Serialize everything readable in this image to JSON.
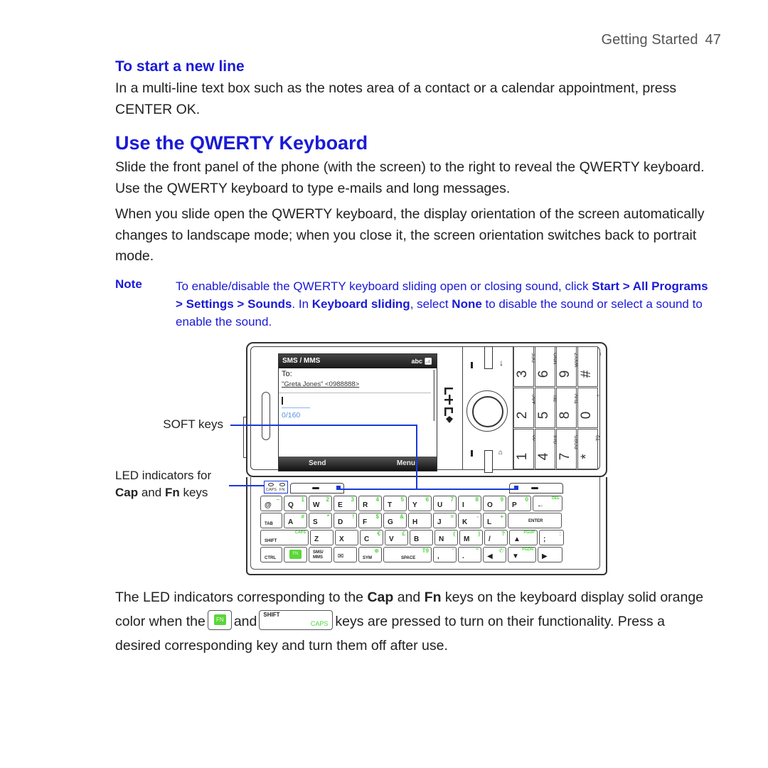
{
  "header": {
    "section": "Getting Started",
    "page_number": "47"
  },
  "new_line": {
    "heading": "To start a new line",
    "body": "In a multi-line text box such as the notes area of a contact or a calendar appointment, press CENTER OK."
  },
  "qwerty": {
    "heading": "Use the QWERTY Keyboard",
    "para1": "Slide the front panel of the phone (with the screen) to the right to reveal the QWERTY keyboard. Use the QWERTY keyboard to type e-mails and long messages.",
    "para2": "When you slide open the QWERTY keyboard, the display orientation of the screen automatically changes to landscape mode; when you close it, the screen orientation switches back to portrait mode."
  },
  "note": {
    "label": "Note",
    "t1": "To enable/disable the QWERTY keyboard sliding open or closing sound, click ",
    "b1": "Start > All Programs > Settings > Sounds",
    "t2": ". In ",
    "b2": "Keyboard sliding",
    "t3": ", select ",
    "b3": "None",
    "t4": " to disable the sound or select a sound to enable the sound."
  },
  "callouts": {
    "soft_keys": "SOFT keys",
    "led_line1": "LED indicators for",
    "led_cap": "Cap",
    "led_and": " and ",
    "led_fn": "Fn",
    "led_keys": " keys"
  },
  "phone_screen": {
    "title": "SMS / MMS",
    "input_mode": "abc",
    "to_label": "To:",
    "recipient": "\"Greta Jones\" <0988888>",
    "char_count": "0/160",
    "soft_left": "Send",
    "soft_right": "Menu"
  },
  "phone_brand": "htc",
  "numpad": [
    {
      "digit": "3",
      "sub": "DEF"
    },
    {
      "digit": "6",
      "sub": "MNO"
    },
    {
      "digit": "9",
      "sub": "WXYZ"
    },
    {
      "digit": "#",
      "sub": "_"
    },
    {
      "digit": "2",
      "sub": "ABC"
    },
    {
      "digit": "5",
      "sub": "JKL"
    },
    {
      "digit": "8",
      "sub": "TUV"
    },
    {
      "digit": "0",
      "sub": "+"
    },
    {
      "digit": "1",
      "sub": "oo"
    },
    {
      "digit": "4",
      "sub": "GHI"
    },
    {
      "digit": "7",
      "sub": "PQRS"
    },
    {
      "digit": "*",
      "sub": "T9"
    }
  ],
  "led_labels": {
    "caps": "CAPS",
    "fn": "FN"
  },
  "keyboard": {
    "row1": [
      {
        "m": "@",
        "f": "–"
      },
      {
        "m": "Q",
        "f": "1"
      },
      {
        "m": "W",
        "f": "2"
      },
      {
        "m": "E",
        "f": "3"
      },
      {
        "m": "R",
        "f": "4"
      },
      {
        "m": "T",
        "f": "5"
      },
      {
        "m": "Y",
        "f": "6"
      },
      {
        "m": "U",
        "f": "7"
      },
      {
        "m": "I",
        "f": "8"
      },
      {
        "m": "O",
        "f": "9"
      },
      {
        "m": "P",
        "f": "0"
      },
      {
        "m": "←",
        "f": "DEL"
      }
    ],
    "row2": [
      {
        "m": "TAB",
        "f": ""
      },
      {
        "m": "A",
        "f": "#"
      },
      {
        "m": "S",
        "f": "*"
      },
      {
        "m": "D",
        "f": "!"
      },
      {
        "m": "F",
        "f": "$"
      },
      {
        "m": "G",
        "f": "&"
      },
      {
        "m": "H",
        "f": ""
      },
      {
        "m": "J",
        "f": "="
      },
      {
        "m": "K",
        "f": "-"
      },
      {
        "m": "L",
        "f": "+"
      },
      {
        "m": "ENTER",
        "f": ""
      }
    ],
    "row3": [
      {
        "m": "SHIFT",
        "f": "CAPS"
      },
      {
        "m": "Z",
        "f": ""
      },
      {
        "m": "X",
        "f": ""
      },
      {
        "m": "C",
        "f": "€"
      },
      {
        "m": "V",
        "f": "£"
      },
      {
        "m": "B",
        "f": ""
      },
      {
        "m": "N",
        "f": "("
      },
      {
        "m": "M",
        "f": ")"
      },
      {
        "m": "/",
        "f": "?"
      },
      {
        "m": "▲",
        "f": "PGUP"
      },
      {
        "m": ";",
        "f": ":"
      }
    ],
    "row4": [
      {
        "m": "CTRL",
        "f": ""
      },
      {
        "m": "FN",
        "f": ""
      },
      {
        "m": "SMS/ MMS",
        "f": ""
      },
      {
        "m": "✉",
        "f": ""
      },
      {
        "m": "SYM",
        "f": "⊕"
      },
      {
        "m": "SPACE",
        "f": "T9"
      },
      {
        "m": ",",
        "f": "'"
      },
      {
        "m": ".",
        "f": "\""
      },
      {
        "m": "◀",
        "f": "✆"
      },
      {
        "m": "▼",
        "f": "PGDN"
      },
      {
        "m": "▶",
        "f": ""
      }
    ]
  },
  "closing": {
    "t1": "The LED indicators corresponding to the ",
    "b1": "Cap",
    "t2": " and ",
    "b2": "Fn",
    "t3": " keys on the keyboard display solid orange color when the",
    "and": "and",
    "t4": "keys are pressed to turn on their functionality. Press a desired corresponding key and turn them off after use.",
    "fn_key_label": "FN",
    "shift_key_label": "SHIFT",
    "caps_label": "CAPS"
  },
  "colors": {
    "heading_blue": "#1a1ad6",
    "fn_green": "#5bd63a",
    "callout_line": "#1a3ad6"
  }
}
